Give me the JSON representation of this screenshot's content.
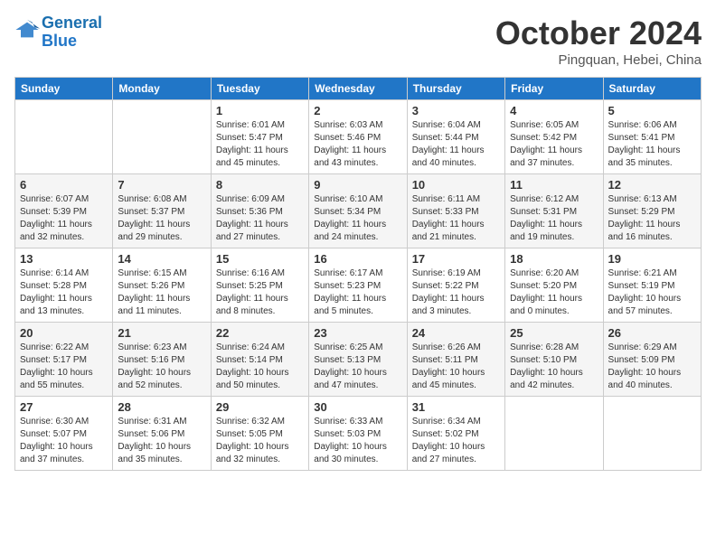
{
  "header": {
    "logo_line1": "General",
    "logo_line2": "Blue",
    "month_title": "October 2024",
    "location": "Pingquan, Hebei, China"
  },
  "weekdays": [
    "Sunday",
    "Monday",
    "Tuesday",
    "Wednesday",
    "Thursday",
    "Friday",
    "Saturday"
  ],
  "weeks": [
    [
      {
        "day": "",
        "sunrise": "",
        "sunset": "",
        "daylight": ""
      },
      {
        "day": "",
        "sunrise": "",
        "sunset": "",
        "daylight": ""
      },
      {
        "day": "1",
        "sunrise": "Sunrise: 6:01 AM",
        "sunset": "Sunset: 5:47 PM",
        "daylight": "Daylight: 11 hours and 45 minutes."
      },
      {
        "day": "2",
        "sunrise": "Sunrise: 6:03 AM",
        "sunset": "Sunset: 5:46 PM",
        "daylight": "Daylight: 11 hours and 43 minutes."
      },
      {
        "day": "3",
        "sunrise": "Sunrise: 6:04 AM",
        "sunset": "Sunset: 5:44 PM",
        "daylight": "Daylight: 11 hours and 40 minutes."
      },
      {
        "day": "4",
        "sunrise": "Sunrise: 6:05 AM",
        "sunset": "Sunset: 5:42 PM",
        "daylight": "Daylight: 11 hours and 37 minutes."
      },
      {
        "day": "5",
        "sunrise": "Sunrise: 6:06 AM",
        "sunset": "Sunset: 5:41 PM",
        "daylight": "Daylight: 11 hours and 35 minutes."
      }
    ],
    [
      {
        "day": "6",
        "sunrise": "Sunrise: 6:07 AM",
        "sunset": "Sunset: 5:39 PM",
        "daylight": "Daylight: 11 hours and 32 minutes."
      },
      {
        "day": "7",
        "sunrise": "Sunrise: 6:08 AM",
        "sunset": "Sunset: 5:37 PM",
        "daylight": "Daylight: 11 hours and 29 minutes."
      },
      {
        "day": "8",
        "sunrise": "Sunrise: 6:09 AM",
        "sunset": "Sunset: 5:36 PM",
        "daylight": "Daylight: 11 hours and 27 minutes."
      },
      {
        "day": "9",
        "sunrise": "Sunrise: 6:10 AM",
        "sunset": "Sunset: 5:34 PM",
        "daylight": "Daylight: 11 hours and 24 minutes."
      },
      {
        "day": "10",
        "sunrise": "Sunrise: 6:11 AM",
        "sunset": "Sunset: 5:33 PM",
        "daylight": "Daylight: 11 hours and 21 minutes."
      },
      {
        "day": "11",
        "sunrise": "Sunrise: 6:12 AM",
        "sunset": "Sunset: 5:31 PM",
        "daylight": "Daylight: 11 hours and 19 minutes."
      },
      {
        "day": "12",
        "sunrise": "Sunrise: 6:13 AM",
        "sunset": "Sunset: 5:29 PM",
        "daylight": "Daylight: 11 hours and 16 minutes."
      }
    ],
    [
      {
        "day": "13",
        "sunrise": "Sunrise: 6:14 AM",
        "sunset": "Sunset: 5:28 PM",
        "daylight": "Daylight: 11 hours and 13 minutes."
      },
      {
        "day": "14",
        "sunrise": "Sunrise: 6:15 AM",
        "sunset": "Sunset: 5:26 PM",
        "daylight": "Daylight: 11 hours and 11 minutes."
      },
      {
        "day": "15",
        "sunrise": "Sunrise: 6:16 AM",
        "sunset": "Sunset: 5:25 PM",
        "daylight": "Daylight: 11 hours and 8 minutes."
      },
      {
        "day": "16",
        "sunrise": "Sunrise: 6:17 AM",
        "sunset": "Sunset: 5:23 PM",
        "daylight": "Daylight: 11 hours and 5 minutes."
      },
      {
        "day": "17",
        "sunrise": "Sunrise: 6:19 AM",
        "sunset": "Sunset: 5:22 PM",
        "daylight": "Daylight: 11 hours and 3 minutes."
      },
      {
        "day": "18",
        "sunrise": "Sunrise: 6:20 AM",
        "sunset": "Sunset: 5:20 PM",
        "daylight": "Daylight: 11 hours and 0 minutes."
      },
      {
        "day": "19",
        "sunrise": "Sunrise: 6:21 AM",
        "sunset": "Sunset: 5:19 PM",
        "daylight": "Daylight: 10 hours and 57 minutes."
      }
    ],
    [
      {
        "day": "20",
        "sunrise": "Sunrise: 6:22 AM",
        "sunset": "Sunset: 5:17 PM",
        "daylight": "Daylight: 10 hours and 55 minutes."
      },
      {
        "day": "21",
        "sunrise": "Sunrise: 6:23 AM",
        "sunset": "Sunset: 5:16 PM",
        "daylight": "Daylight: 10 hours and 52 minutes."
      },
      {
        "day": "22",
        "sunrise": "Sunrise: 6:24 AM",
        "sunset": "Sunset: 5:14 PM",
        "daylight": "Daylight: 10 hours and 50 minutes."
      },
      {
        "day": "23",
        "sunrise": "Sunrise: 6:25 AM",
        "sunset": "Sunset: 5:13 PM",
        "daylight": "Daylight: 10 hours and 47 minutes."
      },
      {
        "day": "24",
        "sunrise": "Sunrise: 6:26 AM",
        "sunset": "Sunset: 5:11 PM",
        "daylight": "Daylight: 10 hours and 45 minutes."
      },
      {
        "day": "25",
        "sunrise": "Sunrise: 6:28 AM",
        "sunset": "Sunset: 5:10 PM",
        "daylight": "Daylight: 10 hours and 42 minutes."
      },
      {
        "day": "26",
        "sunrise": "Sunrise: 6:29 AM",
        "sunset": "Sunset: 5:09 PM",
        "daylight": "Daylight: 10 hours and 40 minutes."
      }
    ],
    [
      {
        "day": "27",
        "sunrise": "Sunrise: 6:30 AM",
        "sunset": "Sunset: 5:07 PM",
        "daylight": "Daylight: 10 hours and 37 minutes."
      },
      {
        "day": "28",
        "sunrise": "Sunrise: 6:31 AM",
        "sunset": "Sunset: 5:06 PM",
        "daylight": "Daylight: 10 hours and 35 minutes."
      },
      {
        "day": "29",
        "sunrise": "Sunrise: 6:32 AM",
        "sunset": "Sunset: 5:05 PM",
        "daylight": "Daylight: 10 hours and 32 minutes."
      },
      {
        "day": "30",
        "sunrise": "Sunrise: 6:33 AM",
        "sunset": "Sunset: 5:03 PM",
        "daylight": "Daylight: 10 hours and 30 minutes."
      },
      {
        "day": "31",
        "sunrise": "Sunrise: 6:34 AM",
        "sunset": "Sunset: 5:02 PM",
        "daylight": "Daylight: 10 hours and 27 minutes."
      },
      {
        "day": "",
        "sunrise": "",
        "sunset": "",
        "daylight": ""
      },
      {
        "day": "",
        "sunrise": "",
        "sunset": "",
        "daylight": ""
      }
    ]
  ]
}
